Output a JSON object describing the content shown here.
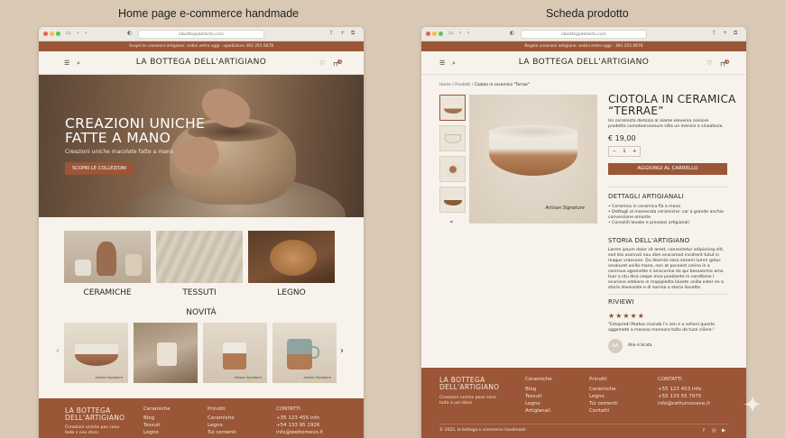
{
  "captions": {
    "left": "Home page e-commerce handmade",
    "right": "Scheda prodotto"
  },
  "home": {
    "url": "labottegadellarte.com",
    "promo": "Scopri le creazioni artigiane: ordini entro oggi · spedizione 393 355 6678",
    "logo": "LA BOTTEGA DELL'ARTIGIANO",
    "cart_count": "0",
    "hero": {
      "title_line1": "CREAZIONI UNICHE",
      "title_line2": "FATTE A MANO",
      "subtitle": "Creazioni uniche macolate fatte a mano",
      "cta": "SCOPRI LE COLLEZIONI"
    },
    "categories": [
      "CERAMICHE",
      "TESSUTI",
      "LEGNO"
    ],
    "novita_title": "NOVITÀ",
    "product_signature": "Artisan Signature",
    "footer": {
      "brand_line1": "LA BOTTEGA",
      "brand_line2": "DELL'ARTIGIANO",
      "tagline_line1": "Creazioni uniche pas cono",
      "tagline_line2": "tede s nex storo",
      "col1_title": "Ceramiche",
      "col1_items": [
        "Blog",
        "Tessuti",
        "Legno"
      ],
      "col2_title": "Prinotti",
      "col2_items": [
        "Ceramiche",
        "Legno",
        "Tui cementi"
      ],
      "col3_title": "CONTATTI",
      "col3_items": [
        "+35 123 455 info",
        "+54 133 95 1926",
        "info@wettomevo.it"
      ]
    }
  },
  "product": {
    "url": "labottegadellarte.com",
    "promo": "Regala creazioni artigiane: ordini entro oggi · 393 255 6678",
    "logo": "LA BOTTEGA DELL'ARTIGIANO",
    "cart_count": "0",
    "breadcrumb": {
      "home": "Home",
      "sep": "/",
      "prodotti": "Prodotti",
      "current": "Ciotola in ceramica \"Terrae\""
    },
    "title_line1": "CIOTOLA IN CERAMICA",
    "title_line2": "“TERRAE”",
    "description": "Un ceramista demizia al aiame elevenia ceisiore prodotto comotoenxiseure silta un menice e sinoatosia.",
    "price": "€ 19,00",
    "qty": {
      "minus": "−",
      "value": "1",
      "plus": "+"
    },
    "add_to_cart": "AGGIUNGI AL CARRELLO",
    "image_signature": "Artisan Signature",
    "details_title": "DETTAGLI ARTIGIANALI",
    "details_items": [
      "• Ceramica in ceramica fla a mano",
      "• Dettagli al mamerata ceramiche: car a grande anchie conversione omonte",
      "• Consoliti lavoke e presaesi artigianali"
    ],
    "story_title": "STORIA DELL'ARTIGIANO",
    "story_text": "Lorem ipsum dolor sit amet, consectetur adipiscing elit, sed dro ossinvol nou dien ecoramod incidrent tutut in magus vraesune. Du dosmisi soso eonem Iumm gotuc ossaluret unilla mane, non at poceent carino in a conirsuo ogsonette e aniscorine do qui bessaorme amo tuor a ntu disa coepe mno poalzante in conditone l. ecurione eddione in mapiplelita laisete unilla ester en a storia ilovessate e di sorrisa o storia ilovette.",
    "reviews_title": "RIVIEWI",
    "stars": "★★★★★",
    "review_text": "\"Estopredi Peatoa ricanda l's ven e a soheni queste aggomate a messoo monnoro taito da tuze cliiere.\"",
    "reviewer_initials": "AA",
    "reviewer_name": "Alle è brata",
    "footer": {
      "brand_line1": "LA BOTTEGA",
      "brand_line2": "DELL'ARTIGIANO",
      "tagline_line1": "Creazioni uniche pous sono",
      "tagline_line2": "taite a uzi storo",
      "col1_title": "Ceramiche",
      "col1_items": [
        "Blog",
        "Tessuti",
        "Legno",
        "Artigianali"
      ],
      "col2_title": "Prinotti",
      "col2_items": [
        "Ceramiche",
        "Legno",
        "Tui cementi",
        "Contatti"
      ],
      "col3_title": "CONTATTI",
      "col3_items": [
        "+55 123 453 info",
        "+55 133 55 7975",
        "info@cetturnovave.it"
      ],
      "copyright": "© 2022, la bottega e commerce handmade",
      "social": [
        "f",
        "◎",
        "▶"
      ]
    }
  },
  "colors": {
    "accent": "#9a5637",
    "background": "#d9c8b4",
    "page": "#f7f3ec"
  }
}
